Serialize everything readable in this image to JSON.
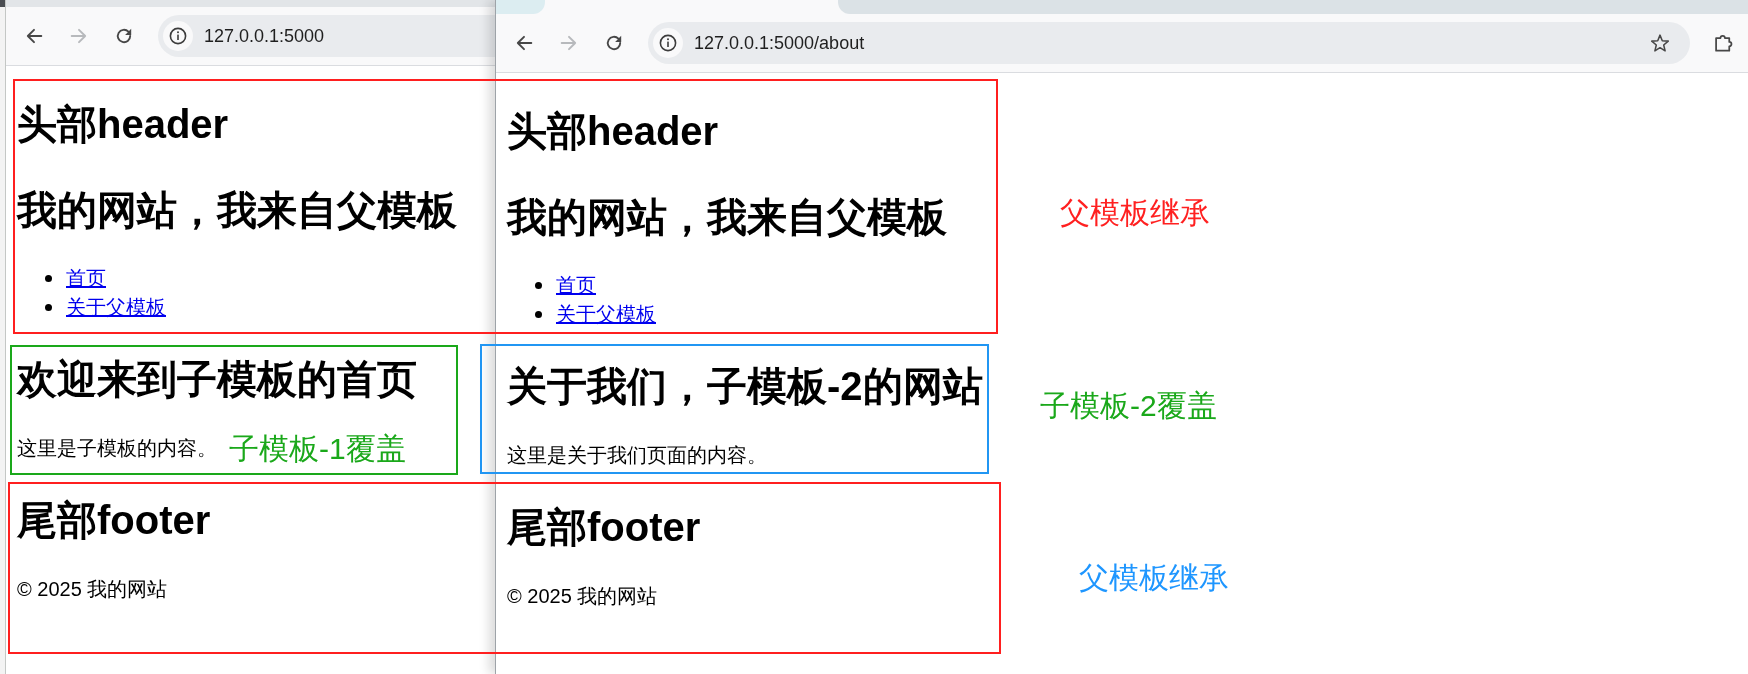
{
  "windows": [
    {
      "toolbar": {
        "buttons": [
          {
            "kind": "back",
            "disabled": false
          },
          {
            "kind": "forward",
            "disabled": true
          },
          {
            "kind": "reload",
            "disabled": false
          }
        ],
        "url": "127.0.0.1:5000"
      },
      "page": {
        "header": {
          "title": "头部header",
          "subtitle": "我的网站，我来自父模板",
          "nav": [
            {
              "label": "首页"
            },
            {
              "label": "关于父模板"
            }
          ]
        },
        "content": {
          "heading": "欢迎来到子模板的首页",
          "text": "这里是子模板的内容。"
        },
        "footer": {
          "title": "尾部footer",
          "text": "© 2025 我的网站"
        }
      }
    },
    {
      "toolbar": {
        "buttons": [
          {
            "kind": "back",
            "disabled": false
          },
          {
            "kind": "forward",
            "disabled": true
          },
          {
            "kind": "reload",
            "disabled": false
          }
        ],
        "url": "127.0.0.1:5000/about",
        "address_actions": [
          {
            "kind": "bookmark"
          }
        ],
        "actions": [
          {
            "kind": "extensions"
          }
        ]
      },
      "page": {
        "header": {
          "title": "头部header",
          "subtitle": "我的网站，我来自父模板",
          "nav": [
            {
              "label": "首页"
            },
            {
              "label": "关于父模板"
            }
          ]
        },
        "content": {
          "heading": "关于我们，子模板-2的网站",
          "text": "这里是关于我们页面的内容。"
        },
        "footer": {
          "title": "尾部footer",
          "text": "© 2025 我的网站"
        }
      }
    }
  ],
  "frames": [
    {
      "color": "#ff1f1f"
    },
    {
      "color": "#1aa81a"
    },
    {
      "color": "#2196f3"
    },
    {
      "color": "#ff1f1f"
    }
  ],
  "notes": [
    {
      "text": "父模板继承",
      "color": "#ff2020"
    },
    {
      "text": "子模板-1覆盖",
      "color": "#1aa81a"
    },
    {
      "text": "子模板-2覆盖",
      "color": "#1aa81a"
    },
    {
      "text": "父模板继承",
      "color": "#1e96ff"
    }
  ]
}
